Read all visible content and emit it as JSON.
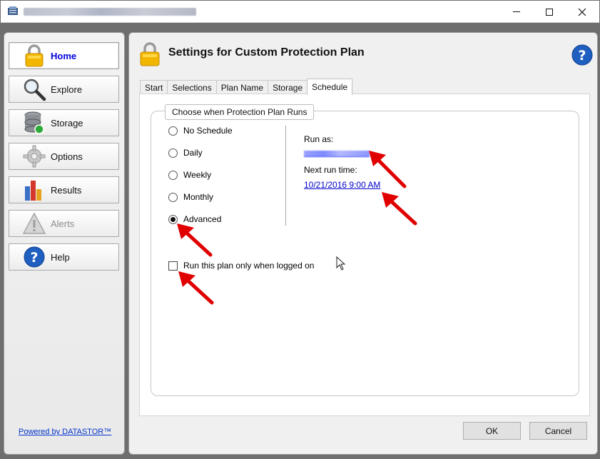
{
  "window": {
    "title_blurred": true
  },
  "sidebar": {
    "items": [
      {
        "label": "Home",
        "icon": "lock-icon",
        "active": true
      },
      {
        "label": "Explore",
        "icon": "magnifier-icon"
      },
      {
        "label": "Storage",
        "icon": "database-icon"
      },
      {
        "label": "Options",
        "icon": "gear-icon"
      },
      {
        "label": "Results",
        "icon": "bar-chart-icon"
      },
      {
        "label": "Alerts",
        "icon": "warning-icon",
        "disabled": true
      },
      {
        "label": "Help",
        "icon": "help-icon"
      }
    ],
    "powered_by": "Powered by DATASTOR™"
  },
  "main": {
    "title": "Settings for Custom Protection Plan",
    "tabs": [
      {
        "label": "Start"
      },
      {
        "label": "Selections"
      },
      {
        "label": "Plan Name"
      },
      {
        "label": "Storage"
      },
      {
        "label": "Schedule",
        "active": true
      }
    ],
    "group_title": "Choose when Protection Plan Runs",
    "schedule_options": [
      {
        "label": "No Schedule",
        "selected": false
      },
      {
        "label": "Daily",
        "selected": false
      },
      {
        "label": "Weekly",
        "selected": false
      },
      {
        "label": "Monthly",
        "selected": false
      },
      {
        "label": "Advanced",
        "selected": true
      }
    ],
    "run_as_label": "Run as:",
    "run_as_value_blurred": true,
    "next_run_label": "Next run time:",
    "next_run_value": "10/21/2016 9:00 AM",
    "logged_on_checkbox": {
      "label": "Run this plan only when logged on",
      "checked": false
    }
  },
  "buttons": {
    "ok": "OK",
    "cancel": "Cancel"
  },
  "colors": {
    "accent_link": "#0000cc",
    "annotation_arrow": "#e00000"
  }
}
